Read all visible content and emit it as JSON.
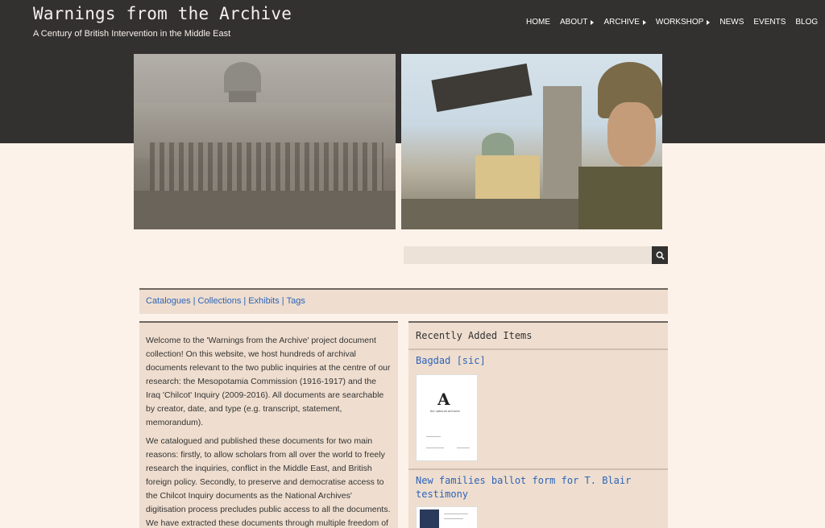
{
  "site": {
    "title": "Warnings from the Archive",
    "subtitle": "A Century of British Intervention in the Middle East"
  },
  "nav": [
    {
      "label": "HOME",
      "dropdown": false
    },
    {
      "label": "ABOUT",
      "dropdown": true
    },
    {
      "label": "ARCHIVE",
      "dropdown": true
    },
    {
      "label": "WORKSHOP",
      "dropdown": true
    },
    {
      "label": "NEWS",
      "dropdown": false
    },
    {
      "label": "EVENTS",
      "dropdown": false
    },
    {
      "label": "BLOG",
      "dropdown": false
    }
  ],
  "search": {
    "placeholder": "",
    "button_icon": "search-icon"
  },
  "browse": {
    "links": [
      "Catalogues",
      "Collections",
      "Exhibits",
      "Tags"
    ],
    "separator": "|"
  },
  "intro": {
    "paragraphs": [
      "Welcome to the 'Warnings from the Archive' project document collection! On this website, we host hundreds of archival documents relevant to the two public inquiries at the centre of our research: the Mesopotamia Commission (1916-1917) and the Iraq 'Chilcot' Inquiry (2009-2016). All documents are searchable by creator, date, and type (e.g. transcript, statement, memorandum).",
      "We catalogued and published these documents for two main reasons: firstly, to allow scholars from all over the world to freely research the inquiries, conflict in the Middle East, and British foreign policy. Secondly, to preserve and democratise access to the Chilcot Inquiry documents as the National Archives' digitisation process precludes public access to all the documents. We have extracted these documents through multiple freedom of information requests, despite having been declassified by the"
    ]
  },
  "recent": {
    "heading": "Recently Added Items",
    "items": [
      {
        "title": "Bagdad [sic]",
        "thumb_logo": "A",
        "thumb_caption": "the national archives"
      },
      {
        "title": "New families ballot form for T. Blair testimony"
      }
    ]
  },
  "colors": {
    "header_bg": "#333030",
    "page_bg": "#fdf2ea",
    "panel_bg": "#efdecf",
    "link": "#2c64b8"
  }
}
